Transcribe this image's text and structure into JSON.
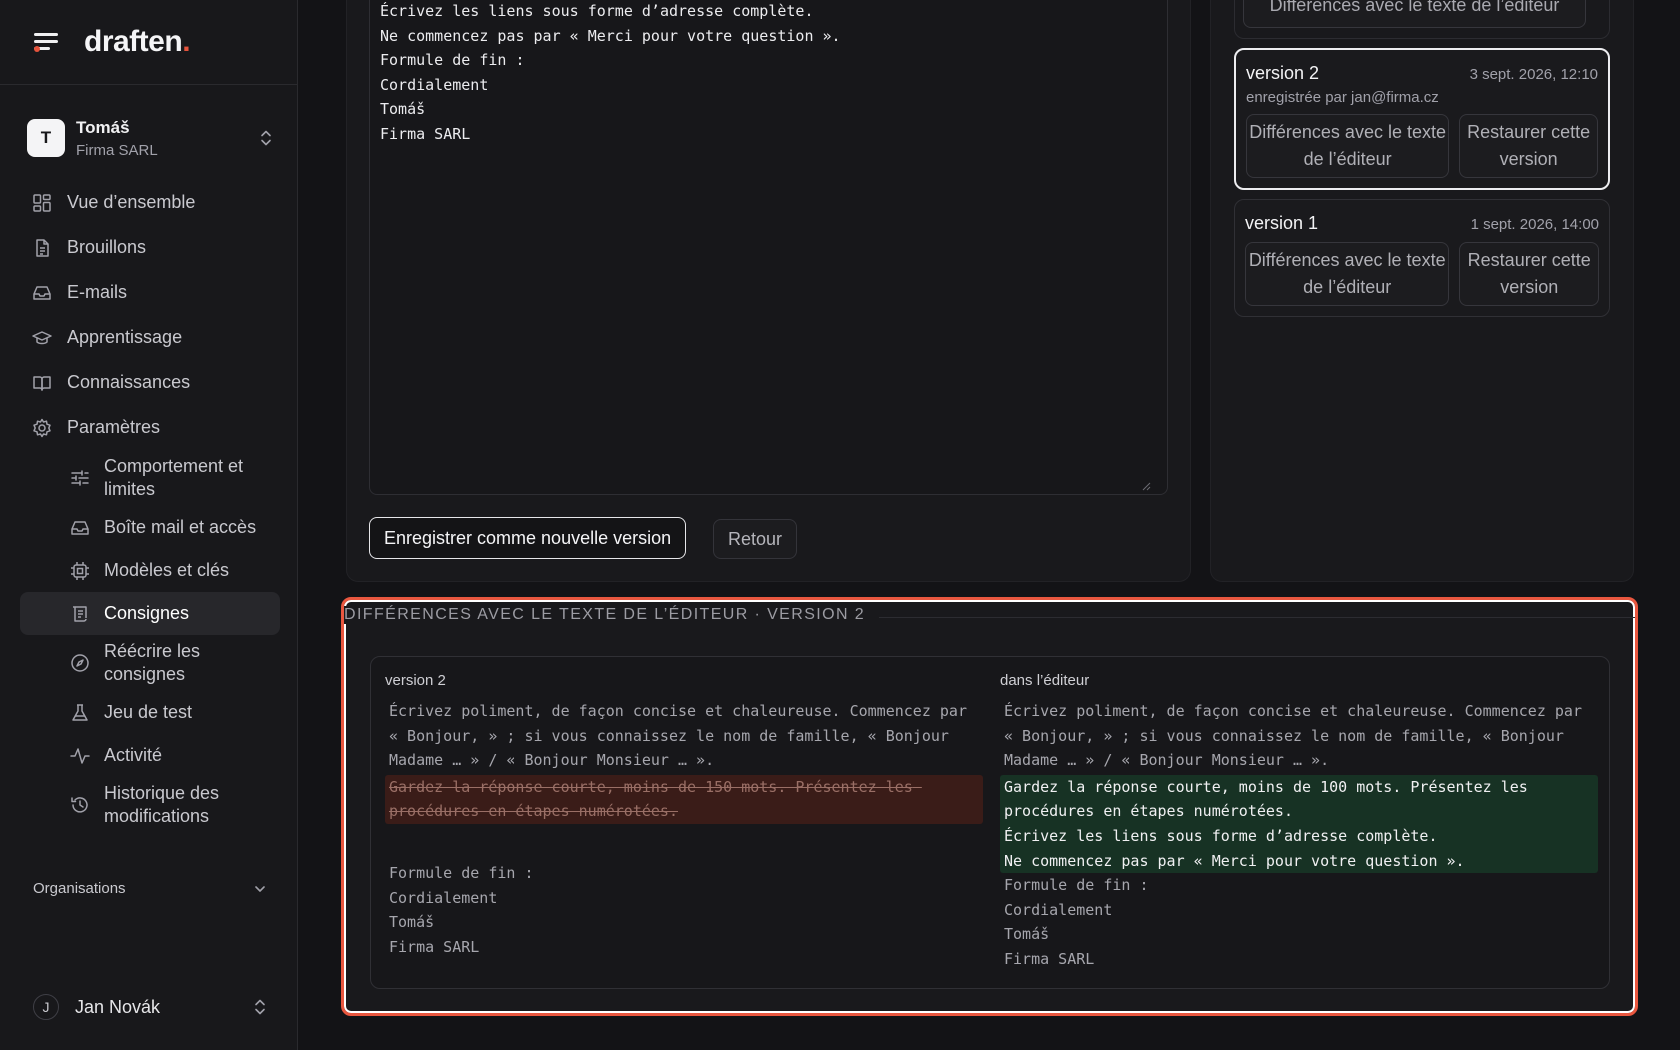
{
  "app": {
    "brand": "draften",
    "brand_dot": "."
  },
  "workspace": {
    "initial": "T",
    "name": "Tomáš",
    "org": "Firma SARL"
  },
  "nav": {
    "items": [
      {
        "label": "Vue d’ensemble",
        "icon": "dashboard-icon"
      },
      {
        "label": "Brouillons",
        "icon": "document-icon"
      },
      {
        "label": "E-mails",
        "icon": "inbox-icon"
      },
      {
        "label": "Apprentissage",
        "icon": "graduation-cap-icon"
      },
      {
        "label": "Connaissances",
        "icon": "book-icon"
      },
      {
        "label": "Paramètres",
        "icon": "gear-icon"
      }
    ],
    "sub_items": [
      {
        "label": "Comportement et limites",
        "icon": "sliders-icon"
      },
      {
        "label": "Boîte mail et accès",
        "icon": "inbox-icon"
      },
      {
        "label": "Modèles et clés",
        "icon": "chip-icon"
      },
      {
        "label": "Consignes",
        "icon": "scroll-icon",
        "active": true
      },
      {
        "label": "Réécrire les consignes",
        "icon": "compass-icon"
      },
      {
        "label": "Jeu de test",
        "icon": "flask-icon"
      },
      {
        "label": "Activité",
        "icon": "activity-icon"
      },
      {
        "label": "Historique des modifications",
        "icon": "history-icon"
      }
    ],
    "organisations_label": "Organisations"
  },
  "user": {
    "initial": "J",
    "name": "Jan Novák"
  },
  "editor": {
    "text": "Écrivez les liens sous forme d’adresse complète.\nNe commencez pas par « Merci pour votre question ».\nFormule de fin :\nCordialement\nTomáš\nFirma SARL",
    "save_label": "Enregistrer comme nouvelle version",
    "back_label": "Retour"
  },
  "versions": {
    "partial_button": "Différences avec le texte de l’éditeur",
    "cards": [
      {
        "title": "version 2",
        "date": "3 sept. 2026, 12:10",
        "by": "enregistrée par jan@firma.cz",
        "diff_label": "Différences avec le texte de l’éditeur",
        "restore_label": "Restaurer cette version",
        "selected": true
      },
      {
        "title": "version 1",
        "date": "1 sept. 2026, 14:00",
        "by": "",
        "diff_label": "Différences avec le texte de l’éditeur",
        "restore_label": "Restaurer cette version",
        "selected": false
      }
    ]
  },
  "diff": {
    "legend": "DIFFÉRENCES AVEC LE TEXTE DE L’ÉDITEUR · VERSION 2",
    "left": {
      "title": "version 2",
      "common_top": "Écrivez poliment, de façon concise et chaleureuse. Commencez par « Bonjour, » ; si vous connaissez le nom de famille, « Bonjour Madame … » / « Bonjour Monsieur … ».",
      "deleted": "Gardez la réponse courte, moins de 150 mots. Présentez les procédures en étapes numérotées.",
      "common_bottom": "Formule de fin :\nCordialement\nTomáš\nFirma SARL"
    },
    "right": {
      "title": "dans l’éditeur",
      "common_top": "Écrivez poliment, de façon concise et chaleureuse. Commencez par « Bonjour, » ; si vous connaissez le nom de famille, « Bonjour Madame … » / « Bonjour Monsieur … ».",
      "inserted": "Gardez la réponse courte, moins de 100 mots. Présentez les procédures en étapes numérotées.\nÉcrivez les liens sous forme d’adresse complète.\nNe commencez pas par « Merci pour votre question ».",
      "common_bottom": "Formule de fin :\nCordialement\nTomáš\nFirma SARL"
    }
  },
  "colors": {
    "accent": "#e5533c",
    "highlight_border": "#e9573f",
    "deleted_bg": "#3a1c18",
    "inserted_bg": "#173224"
  }
}
